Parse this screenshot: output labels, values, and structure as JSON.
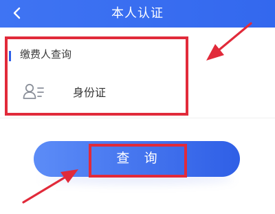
{
  "header": {
    "title": "本人认证",
    "back_icon": "chevron-left-icon"
  },
  "card": {
    "section_title": "缴费人查询",
    "id_row": {
      "icon": "id-card-icon",
      "label": "身份证"
    }
  },
  "query_button": {
    "label": "查 询"
  },
  "colors": {
    "header_bg": "#3f74f3",
    "accent": "#2d5ee8",
    "button_start": "#5c8cf7",
    "button_end": "#2f5fe6",
    "annotation": "#e12a3a"
  }
}
